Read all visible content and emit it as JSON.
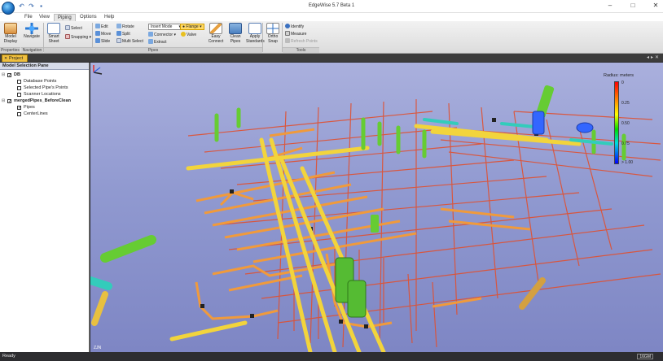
{
  "app": {
    "title": "EdgeWise 5.7 Beta 1",
    "qat_icons": [
      "undo-icon",
      "redo-icon",
      "save-icon"
    ]
  },
  "menu": {
    "tabs": [
      {
        "label": "File"
      },
      {
        "label": "View"
      },
      {
        "label": "Piping",
        "active": true
      },
      {
        "label": "Options"
      },
      {
        "label": "Help"
      }
    ]
  },
  "ribbon": {
    "model_display": "Model Display",
    "navigate": "Navigate",
    "smart_sheet": "Smart Sheet",
    "select": "Select",
    "snapping": "Snapping",
    "edit": "Edit",
    "move": "Move",
    "slide": "Slide",
    "rotate": "Rotate",
    "split": "Split",
    "multi_select": "Multi Select",
    "insert_mode": "Insert Mode",
    "flange": "Flange",
    "connector": "Connector",
    "valve": "Valve",
    "extract": "Extract",
    "easy_connect": "Easy Connect",
    "clean_pipes": "Clean Pipes",
    "apply_standards": "Apply Standards",
    "ortho_snap": "Ortho Snap",
    "identify": "Identify",
    "measure": "Measure",
    "refresh_points": "Refresh Points",
    "groups": {
      "properties": "Properties",
      "navigation": "Navigation",
      "pipes": "Pipes",
      "tools": "Tools"
    }
  },
  "document_tab": {
    "label": "Project"
  },
  "selection_pane": {
    "title": "Model Selection Pane",
    "items": [
      {
        "label": "DB",
        "level": 0,
        "checked": true,
        "bold": true,
        "expandable": true
      },
      {
        "label": "Database Points",
        "level": 1,
        "checked": false
      },
      {
        "label": "Selected Pipe's Points",
        "level": 1,
        "checked": false
      },
      {
        "label": "Scanner Locations",
        "level": 1,
        "checked": false
      },
      {
        "label": "mergedPipes_BeforeClean",
        "level": 0,
        "checked": true,
        "bold": true,
        "expandable": true
      },
      {
        "label": "Pipes",
        "level": 1,
        "checked": true
      },
      {
        "label": "CenterLines",
        "level": 1,
        "checked": false
      }
    ]
  },
  "legend": {
    "title": "Radius: meters",
    "ticks": [
      "0",
      "0.25",
      "0.50",
      "0.75",
      "> 1.00"
    ],
    "colors": [
      "#ff0000",
      "#ff8800",
      "#ffff00",
      "#00dd00",
      "#00dddd",
      "#0000ff"
    ]
  },
  "viewport": {
    "frame_label": "ZJN"
  },
  "status": {
    "text": "Ready",
    "memory": "16GM"
  },
  "colors": {
    "pipe_yellow": "#f2d43c",
    "pipe_orange": "#f09a3c",
    "pipe_red": "#e05030",
    "pipe_green": "#66cc33",
    "pipe_cyan": "#33ccbb",
    "pipe_blue": "#3366ff",
    "accent_tab": "#f0c040"
  }
}
